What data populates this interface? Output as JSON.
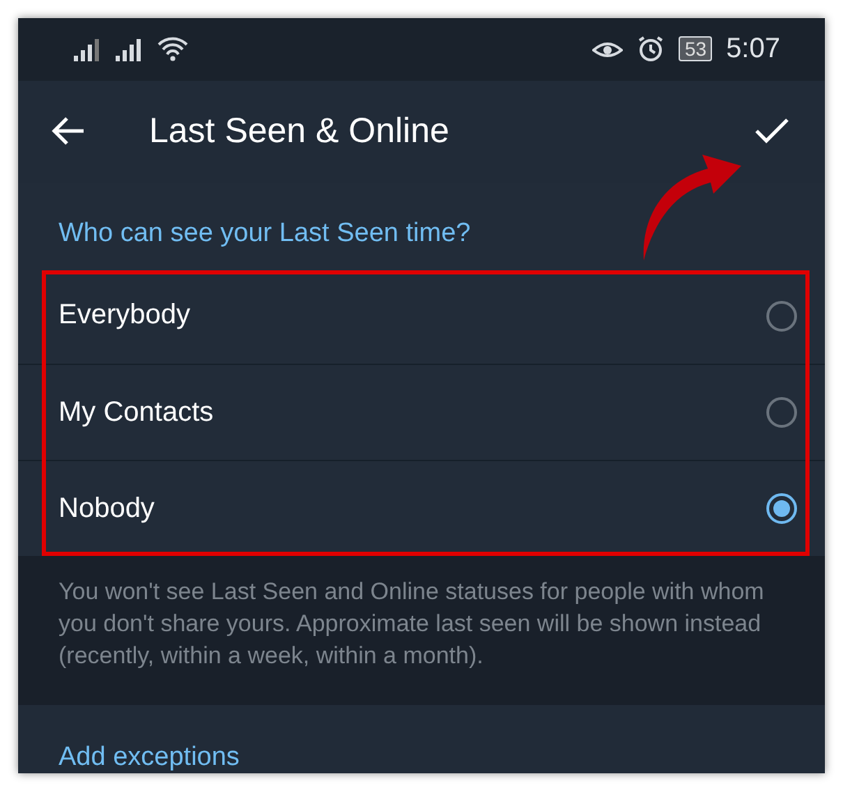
{
  "status_bar": {
    "battery": "53",
    "time": "5:07"
  },
  "app_bar": {
    "title": "Last Seen & Online"
  },
  "section": {
    "header": "Who can see your Last Seen time?",
    "options": [
      {
        "label": "Everybody",
        "selected": false
      },
      {
        "label": "My Contacts",
        "selected": false
      },
      {
        "label": "Nobody",
        "selected": true
      }
    ]
  },
  "hint": "You won't see Last Seen and Online statuses for people with whom you don't share yours. Approximate last seen will be shown instead (recently, within a week, within a month).",
  "exceptions": {
    "header": "Add exceptions"
  }
}
